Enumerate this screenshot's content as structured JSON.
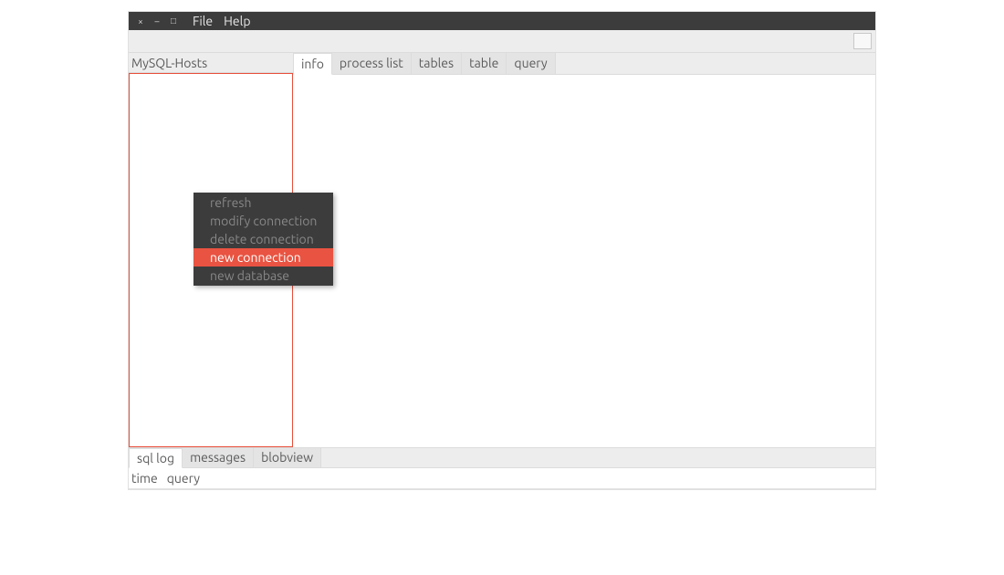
{
  "titlebar": {
    "close_symbol": "×",
    "minimize_symbol": "–",
    "maximize_symbol": "□"
  },
  "menubar": {
    "file": "File",
    "help": "Help"
  },
  "sidebar": {
    "header": "MySQL-Hosts"
  },
  "main_tabs": [
    {
      "id": "info",
      "label": "info",
      "active": true
    },
    {
      "id": "processlist",
      "label": "process list",
      "active": false
    },
    {
      "id": "tables",
      "label": "tables",
      "active": false
    },
    {
      "id": "table",
      "label": "table",
      "active": false
    },
    {
      "id": "query",
      "label": "query",
      "active": false
    }
  ],
  "bottom_tabs": [
    {
      "id": "sqllog",
      "label": "sql log",
      "active": true
    },
    {
      "id": "messages",
      "label": "messages",
      "active": false
    },
    {
      "id": "blobview",
      "label": "blobview",
      "active": false
    }
  ],
  "log_columns": {
    "time": "time",
    "query": "query"
  },
  "context_menu": {
    "items": [
      {
        "id": "refresh",
        "label": "refresh",
        "enabled": false,
        "highlighted": false
      },
      {
        "id": "modify",
        "label": "modify connection",
        "enabled": false,
        "highlighted": false
      },
      {
        "id": "delete",
        "label": "delete connection",
        "enabled": false,
        "highlighted": false
      },
      {
        "id": "newconn",
        "label": "new connection",
        "enabled": true,
        "highlighted": true
      },
      {
        "id": "newdb",
        "label": "new database",
        "enabled": false,
        "highlighted": false
      }
    ]
  }
}
